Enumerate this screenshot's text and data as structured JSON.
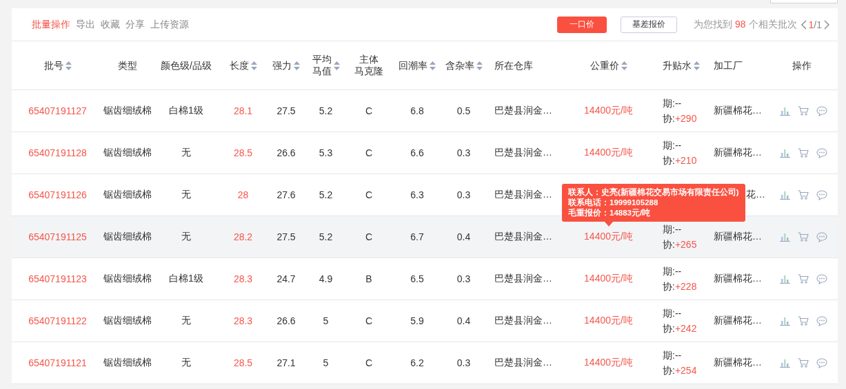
{
  "toolbar": {
    "links": [
      {
        "label": "批量操作",
        "selected": true
      },
      {
        "label": "导出",
        "selected": false
      },
      {
        "label": "收藏",
        "selected": false
      },
      {
        "label": "分享",
        "selected": false
      },
      {
        "label": "上传资源",
        "selected": false
      }
    ],
    "price_buttons": [
      {
        "label": "一口价",
        "selected": true
      },
      {
        "label": "基差报价",
        "selected": false
      }
    ],
    "result": {
      "prefix": "为您找到",
      "count": "98",
      "suffix": "个相关批次"
    },
    "pager": {
      "current": "1",
      "total": "/1"
    }
  },
  "table": {
    "columns": [
      {
        "label": "批号",
        "sortable": true
      },
      {
        "label": "类型",
        "sortable": false
      },
      {
        "label": "颜色级/品级",
        "sortable": false
      },
      {
        "label": "长度",
        "sortable": true
      },
      {
        "label": "强力",
        "sortable": true
      },
      {
        "label": "平均马值",
        "sortable": true
      },
      {
        "label": "主体马克隆",
        "sortable": false
      },
      {
        "label": "回潮率",
        "sortable": true
      },
      {
        "label": "含杂率",
        "sortable": true
      },
      {
        "label": "所在仓库",
        "sortable": false
      },
      {
        "label": "公重价",
        "sortable": true
      },
      {
        "label": "升贴水",
        "sortable": true
      },
      {
        "label": "加工厂",
        "sortable": false
      },
      {
        "label": "操作",
        "sortable": false
      }
    ],
    "rows": [
      {
        "lot": "65407191127",
        "type": "锯齿细绒棉",
        "grade": "白棉1级",
        "length": "28.1",
        "strength": "27.5",
        "mic_avg": "5.2",
        "mic_main": "C",
        "moisture": "6.8",
        "trash": "0.5",
        "warehouse": "巴楚县润金…",
        "price": "14400元/吨",
        "futures": "期:--",
        "basis_label": "协:",
        "basis": "+290",
        "factory": "新疆棉花…",
        "highlighted": false,
        "covered": false
      },
      {
        "lot": "65407191128",
        "type": "锯齿细绒棉",
        "grade": "无",
        "length": "28.5",
        "strength": "26.6",
        "mic_avg": "5.3",
        "mic_main": "C",
        "moisture": "6.6",
        "trash": "0.3",
        "warehouse": "巴楚县润金…",
        "price": "14400元/吨",
        "futures": "期:--",
        "basis_label": "协:",
        "basis": "+210",
        "factory": "新疆棉花…",
        "highlighted": false,
        "covered": false
      },
      {
        "lot": "65407191126",
        "type": "锯齿细绒棉",
        "grade": "无",
        "length": "28",
        "strength": "27.6",
        "mic_avg": "5.2",
        "mic_main": "C",
        "moisture": "6.3",
        "trash": "0.3",
        "warehouse": "巴楚县润金…",
        "factory": "花…",
        "highlighted": false,
        "covered": true
      },
      {
        "lot": "65407191125",
        "type": "锯齿细绒棉",
        "grade": "无",
        "length": "28.2",
        "strength": "27.5",
        "mic_avg": "5.2",
        "mic_main": "C",
        "moisture": "6.7",
        "trash": "0.4",
        "warehouse": "巴楚县润金…",
        "price": "14400元/吨",
        "futures": "期:--",
        "basis_label": "协:",
        "basis": "+265",
        "factory": "新疆棉花…",
        "highlighted": true,
        "covered": false,
        "tooltip": [
          "联系人：史亮(新疆棉花交易市场有限责任公司)",
          "联系电话：19999105288",
          "毛重报价：14883元/吨"
        ]
      },
      {
        "lot": "65407191123",
        "type": "锯齿细绒棉",
        "grade": "白棉1级",
        "length": "28.3",
        "strength": "24.7",
        "mic_avg": "4.9",
        "mic_main": "B",
        "moisture": "6.5",
        "trash": "0.3",
        "warehouse": "巴楚县润金…",
        "price": "14400元/吨",
        "futures": "期:--",
        "basis_label": "协:",
        "basis": "+228",
        "factory": "新疆棉花…",
        "highlighted": false,
        "covered": false
      },
      {
        "lot": "65407191122",
        "type": "锯齿细绒棉",
        "grade": "无",
        "length": "28.3",
        "strength": "26.6",
        "mic_avg": "5",
        "mic_main": "C",
        "moisture": "5.9",
        "trash": "0.4",
        "warehouse": "巴楚县润金…",
        "price": "14400元/吨",
        "futures": "期:--",
        "basis_label": "协:",
        "basis": "+242",
        "factory": "新疆棉花…",
        "highlighted": false,
        "covered": false
      },
      {
        "lot": "65407191121",
        "type": "锯齿细绒棉",
        "grade": "无",
        "length": "28.5",
        "strength": "27.1",
        "mic_avg": "5",
        "mic_main": "C",
        "moisture": "6.2",
        "trash": "0.3",
        "warehouse": "巴楚县润金…",
        "price": "14400元/吨",
        "futures": "期:--",
        "basis_label": "协:",
        "basis": "+254",
        "factory": "新疆棉花…",
        "highlighted": false,
        "covered": false
      }
    ]
  }
}
